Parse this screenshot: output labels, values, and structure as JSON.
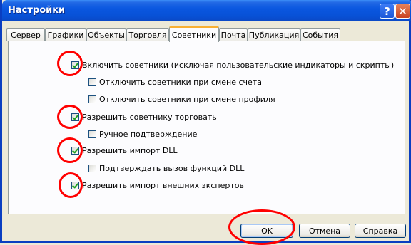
{
  "window": {
    "title": "Настройки"
  },
  "titlebar": {
    "help_glyph": "?",
    "close_glyph": "✕"
  },
  "tabs": [
    "Сервер",
    "Графики",
    "Объекты",
    "Торговля",
    "Советники",
    "Почта",
    "Публикация",
    "События"
  ],
  "active_tab": "Советники",
  "options": [
    {
      "label": "Включить советники (исключая пользовательские индикаторы и скрипты)",
      "checked": true
    },
    {
      "label": "Отключить советники при смене счета",
      "checked": false
    },
    {
      "label": "Отключить советники при смене профиля",
      "checked": false
    },
    {
      "label": "Разрешить советнику торговать",
      "checked": true
    },
    {
      "label": "Ручное подтверждение",
      "checked": false
    },
    {
      "label": "Разрешить импорт DLL",
      "checked": true
    },
    {
      "label": "Подтверждать вызов функций DLL",
      "checked": false
    },
    {
      "label": "Разрешить импорт внешних экспертов",
      "checked": true
    }
  ],
  "buttons": {
    "ok": "OK",
    "cancel": "Отмена",
    "help": "Справка"
  },
  "colors": {
    "annotation": "#ff0000",
    "title_bar": "#0a57e0",
    "check": "#21a121"
  }
}
